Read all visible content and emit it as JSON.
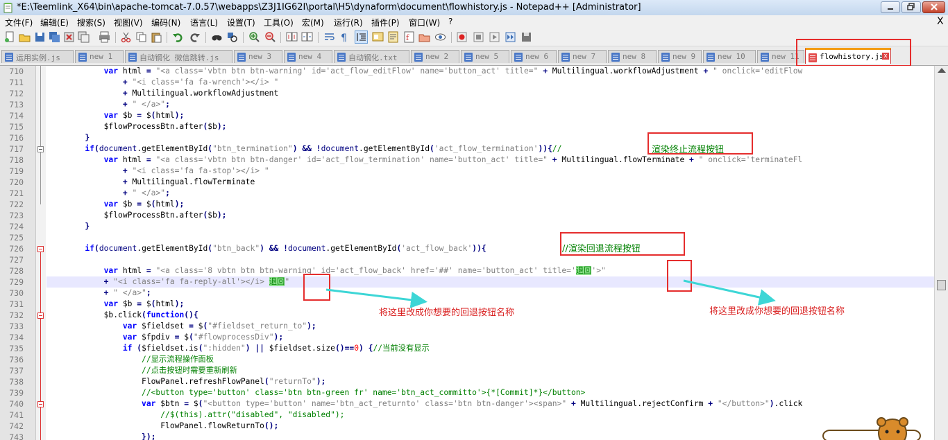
{
  "window": {
    "title": "*E:\\Teemlink_X64\\bin\\apache-tomcat-7.0.57\\webapps\\Z3J1IG62I\\portal\\H5\\dynaform\\document\\flowhistory.js - Notepad++ [Administrator]"
  },
  "menubar": {
    "items": [
      "文件(F)",
      "编辑(E)",
      "搜索(S)",
      "视图(V)",
      "编码(N)",
      "语言(L)",
      "设置(T)",
      "工具(O)",
      "宏(M)",
      "运行(R)",
      "插件(P)",
      "窗口(W)",
      "?"
    ],
    "close_glyph": "X"
  },
  "tabs": [
    {
      "label": "运用实例.js"
    },
    {
      "label": "new 1"
    },
    {
      "label": "自动钢化 微信跳转.js"
    },
    {
      "label": "new 3"
    },
    {
      "label": "new 4"
    },
    {
      "label": "自动钢化.txt"
    },
    {
      "label": "new 2"
    },
    {
      "label": "new 5"
    },
    {
      "label": "new 6"
    },
    {
      "label": "new 7"
    },
    {
      "label": "new 8"
    },
    {
      "label": "new 9"
    },
    {
      "label": "new 10"
    },
    {
      "label": "new 11"
    },
    {
      "label": "flowhistory.js",
      "active": true
    }
  ],
  "editor": {
    "line_numbers": [
      "710",
      "711",
      "712",
      "713",
      "714",
      "715",
      "716",
      "717",
      "718",
      "719",
      "720",
      "721",
      "722",
      "723",
      "724",
      "725",
      "726",
      "727",
      "728",
      "729",
      "730",
      "731",
      "732",
      "733",
      "734",
      "735",
      "736",
      "737",
      "738",
      "739",
      "740",
      "741",
      "742",
      "743"
    ],
    "current_line": "729"
  },
  "annotations": {
    "comment_termination": "渲染终止流程按钮",
    "comment_back": "//渲染回退流程按钮",
    "note_left": "将这里改成你想要的回退按钮名称",
    "note_right": "将这里改成你想要的回退按钮名称"
  },
  "colors": {
    "keyword": "#0000ff",
    "string": "#808080",
    "comment": "#008000",
    "annotation_box": "#e52d2d",
    "arrow": "#3dd6d6"
  }
}
